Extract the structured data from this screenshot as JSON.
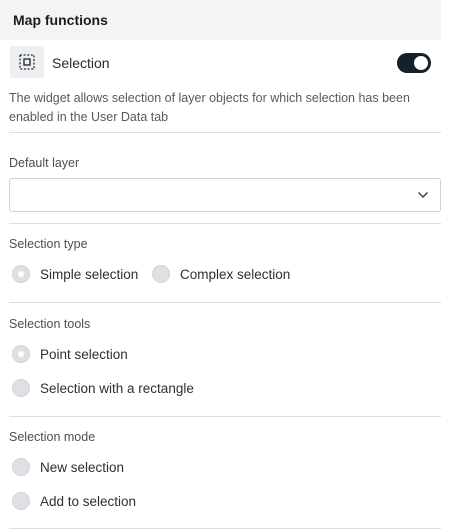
{
  "header": {
    "title": "Map functions"
  },
  "function": {
    "icon": "selection-icon",
    "label": "Selection",
    "enabled": true,
    "description": "The widget allows selection of layer objects for which selection has been enabled in the User Data tab"
  },
  "default_layer": {
    "label": "Default layer",
    "value": "",
    "icon": "chevron-down-icon"
  },
  "selection_type": {
    "label": "Selection type",
    "options": [
      {
        "label": "Simple selection",
        "checked": true
      },
      {
        "label": "Complex selection",
        "checked": false
      }
    ]
  },
  "selection_tools": {
    "label": "Selection tools",
    "options": [
      {
        "label": "Point selection",
        "checked": true
      },
      {
        "label": "Selection with a rectangle",
        "checked": false
      }
    ]
  },
  "selection_mode": {
    "label": "Selection mode",
    "options": [
      {
        "label": "New selection",
        "checked": false
      },
      {
        "label": "Add to selection",
        "checked": false
      }
    ]
  },
  "colors": {
    "toggle_on": "#15202f",
    "header_bg": "#f3f4f5",
    "radio_fill": "#dfe0e3"
  }
}
